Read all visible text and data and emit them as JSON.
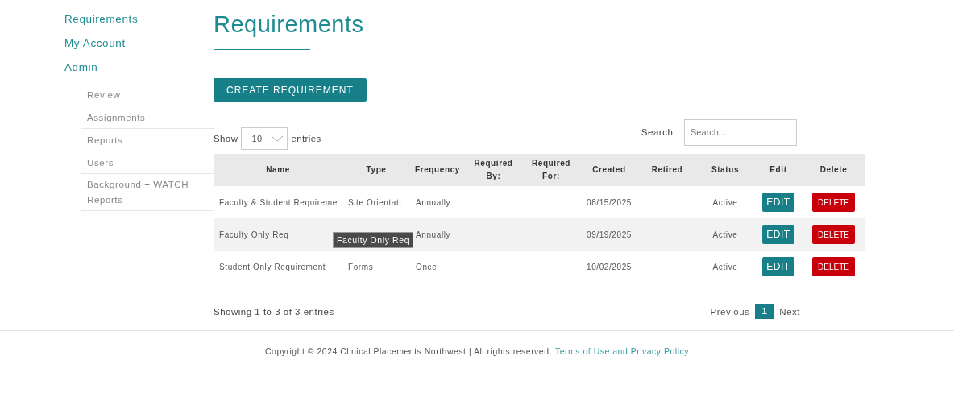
{
  "sidebar": {
    "items": [
      {
        "label": "Requirements"
      },
      {
        "label": "My Account"
      },
      {
        "label": "Admin",
        "children": [
          {
            "label": "Review"
          },
          {
            "label": "Assignments"
          },
          {
            "label": "Reports"
          },
          {
            "label": "Users"
          },
          {
            "label": "Background + WATCH Reports"
          }
        ]
      }
    ]
  },
  "page": {
    "title": "Requirements",
    "create_button": "CREATE REQUIREMENT"
  },
  "table_controls": {
    "show_label": "Show",
    "page_size": "10",
    "entries_label": "entries",
    "search_label": "Search:",
    "search_placeholder": "Search..."
  },
  "table": {
    "columns": [
      "Name",
      "Type",
      "Frequency",
      "Required By:",
      "Required For:",
      "Created",
      "Retired",
      "Status",
      "Edit",
      "Delete"
    ],
    "rows": [
      {
        "name": "Faculty & Student Requireme",
        "type": "Site Orientati",
        "frequency": "Annually",
        "created": "08/15/2025",
        "status": "Active",
        "edit": "EDIT",
        "delete": "DELETE"
      },
      {
        "name": "Faculty Only Req",
        "frequency": "Annually",
        "created": "09/19/2025",
        "status": "Active",
        "edit": "EDIT",
        "delete": "DELETE",
        "tooltip": "Faculty Only Req"
      },
      {
        "name": "Student Only Requirement",
        "type": "Forms",
        "frequency": "Once",
        "created": "10/02/2025",
        "status": "Active",
        "edit": "EDIT",
        "delete": "DELETE"
      }
    ]
  },
  "table_footer": {
    "info": "Showing 1 to 3 of 3 entries",
    "previous": "Previous",
    "pages": [
      {
        "label": "1",
        "selected": true
      }
    ],
    "next": "Next"
  },
  "footer": {
    "copyright": "Copyright © 2024 Clinical Placements Northwest | All rights reserved.",
    "link": "Terms of Use and Privacy Policy"
  }
}
